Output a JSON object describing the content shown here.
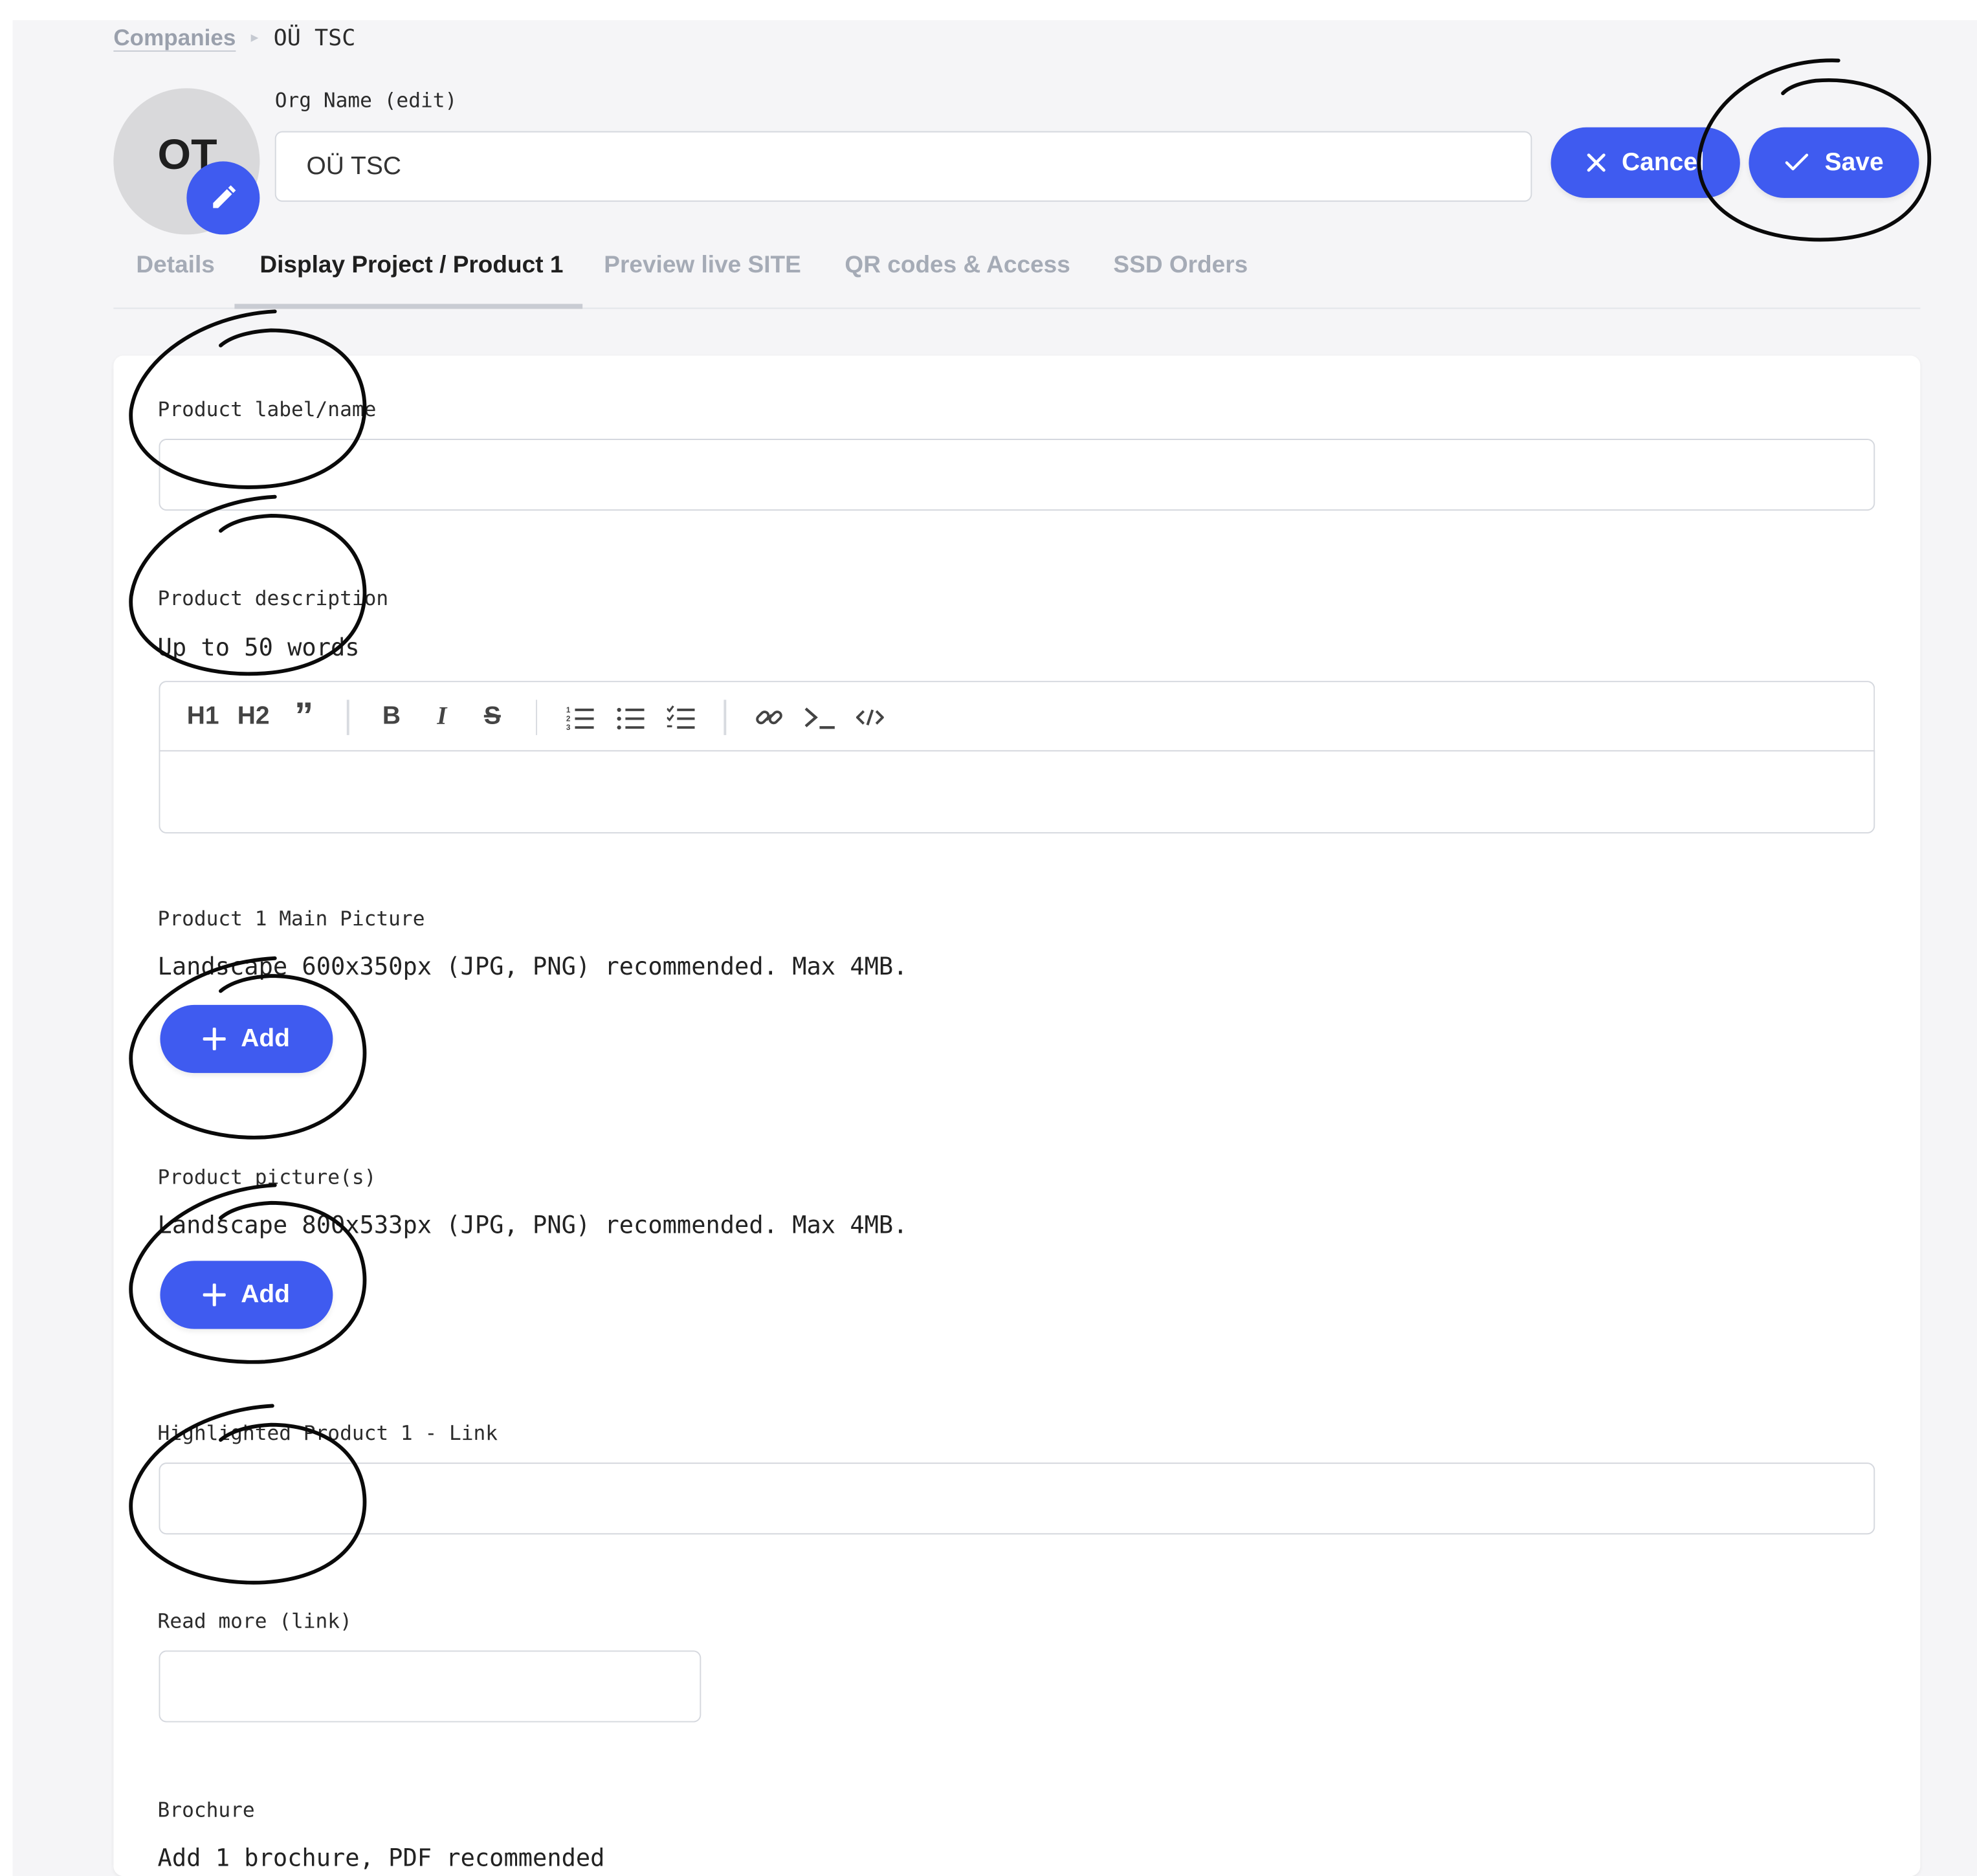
{
  "breadcrumb": {
    "parent": "Companies",
    "current": "OÜ TSC"
  },
  "avatar": {
    "initials": "OT"
  },
  "org": {
    "label": "Org Name (edit)",
    "value": "OÜ TSC"
  },
  "actions": {
    "cancel": "Cancel",
    "save": "Save"
  },
  "tabs": [
    {
      "label": "Details"
    },
    {
      "label": "Display Project / Product 1"
    },
    {
      "label": "Preview live SITE"
    },
    {
      "label": "QR codes & Access"
    },
    {
      "label": "SSD Orders"
    }
  ],
  "form": {
    "product_name": {
      "label": "Product label/name",
      "value": ""
    },
    "product_description": {
      "label": "Product description",
      "hint": "Up to 50 words"
    },
    "main_picture": {
      "label": "Product 1 Main Picture",
      "hint": "Landscape 600x350px (JPG, PNG) recommended. Max 4MB.",
      "button": "Add"
    },
    "pictures": {
      "label": "Product picture(s)",
      "hint": "Landscape 800x533px (JPG, PNG) recommended. Max 4MB.",
      "button": "Add"
    },
    "highlighted_link": {
      "label": "Highlighted Product 1 - Link",
      "value": ""
    },
    "read_more": {
      "label": "Read more (link)",
      "value": ""
    },
    "brochure": {
      "label": "Brochure",
      "hint": "Add 1 brochure, PDF recommended"
    }
  },
  "editor_toolbar": {
    "h1": "H1",
    "h2": "H2",
    "quote": "”",
    "bold": "B",
    "italic": "I",
    "strike": "S"
  },
  "colors": {
    "accent": "#3f5bf0",
    "tab_inactive": "#a5abb6",
    "border": "#d5d8de"
  }
}
